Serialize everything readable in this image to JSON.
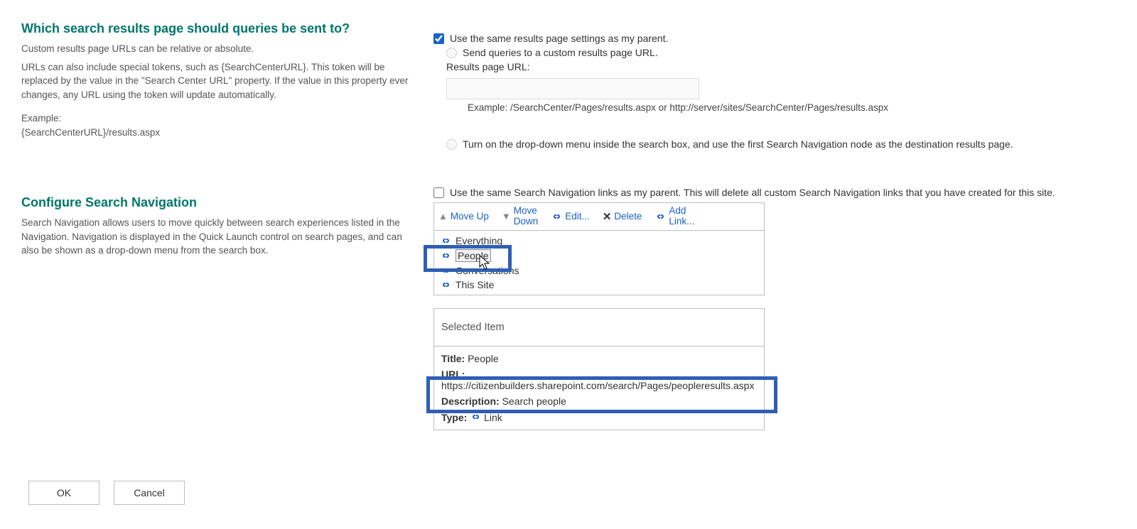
{
  "section1": {
    "heading": "Which search results page should queries be sent to?",
    "desc1": "Custom results page URLs can be relative or absolute.",
    "desc2": "URLs can also include special tokens, such as {SearchCenterURL}. This token will be replaced by the value in the \"Search Center URL\" property. If the value in this property ever changes, any URL using the token will update automatically.",
    "desc3a": "Example:",
    "desc3b": "{SearchCenterURL}/results.aspx",
    "opt_same_parent": "Use the same results page settings as my parent.",
    "opt_custom": "Send queries to a custom results page URL.",
    "url_label": "Results page URL:",
    "url_example": "Example: /SearchCenter/Pages/results.aspx or http://server/sites/SearchCenter/Pages/results.aspx",
    "opt_dropdown": "Turn on the drop-down menu inside the search box, and use the first Search Navigation node as the destination results page."
  },
  "section2": {
    "heading": "Configure Search Navigation",
    "desc": "Search Navigation allows users to move quickly between search experiences listed in the Navigation. Navigation is displayed in the Quick Launch control on search pages, and can also be shown as a drop-down menu from the search box.",
    "chk_same_parent": "Use the same Search Navigation links as my parent. This will delete all custom Search Navigation links that you have created for this site.",
    "toolbar": {
      "moveup": "Move Up",
      "movedown_l1": "Move",
      "movedown_l2": "Down",
      "edit": "Edit...",
      "del": "Delete",
      "addlink_l1": "Add",
      "addlink_l2": "Link..."
    },
    "nav_items": [
      "Everything",
      "People",
      "Conversations",
      "This Site"
    ],
    "selected_header": "Selected Item",
    "sel": {
      "title_k": "Title:",
      "title_v": "People",
      "url_k": "URL:",
      "url_v": "https://citizenbuilders.sharepoint.com/search/Pages/peopleresults.aspx",
      "desc_k": "Description:",
      "desc_v": "Search people",
      "type_k": "Type:",
      "type_v": "Link"
    }
  },
  "buttons": {
    "ok": "OK",
    "cancel": "Cancel"
  }
}
